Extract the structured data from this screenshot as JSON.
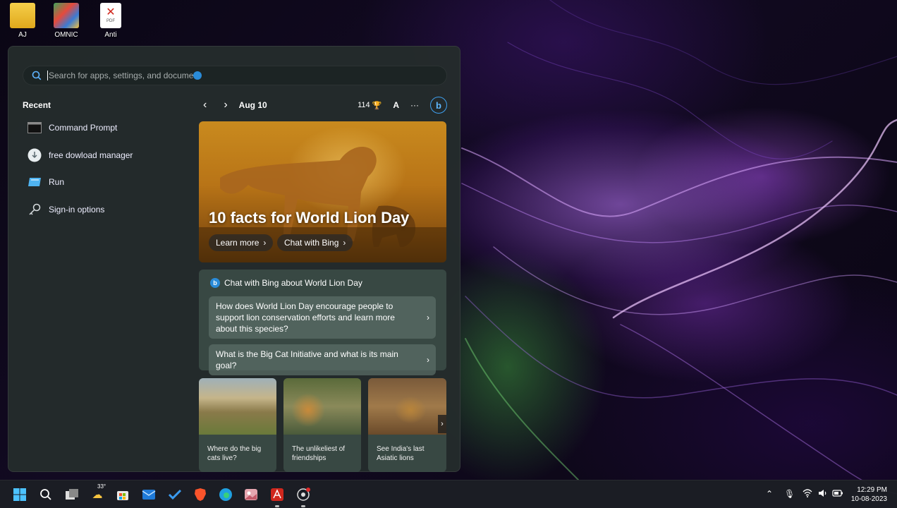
{
  "desktop": {
    "icons": [
      {
        "label": "AJ"
      },
      {
        "label": "OMNIC"
      },
      {
        "label": "Anti",
        "sub": "PDF"
      }
    ]
  },
  "start_menu": {
    "search": {
      "placeholder": "Search for apps, settings, and docume"
    },
    "recent": {
      "title": "Recent",
      "items": [
        {
          "label": "Command Prompt"
        },
        {
          "label": "free dowload manager"
        },
        {
          "label": "Run"
        },
        {
          "label": "Sign-in options"
        }
      ]
    },
    "feed": {
      "date": "Aug 10",
      "points": "114",
      "avatar_letter": "A",
      "more": "···",
      "hero": {
        "title": "10 facts for World Lion Day",
        "learn_more": "Learn more",
        "chat_with_bing": "Chat with Bing"
      },
      "chat": {
        "title": "Chat with Bing about World Lion Day",
        "questions": [
          "How does World Lion Day encourage people to support lion conservation efforts and learn more about this species?",
          "What is the Big Cat Initiative and what is its main goal?"
        ]
      },
      "tiles": [
        {
          "caption": "Where do the big cats live?"
        },
        {
          "caption": "The unlikeliest of friendships"
        },
        {
          "caption": "See India's last Asiatic lions"
        }
      ]
    }
  },
  "taskbar": {
    "weather_temp": "33°",
    "time": "12:29 PM",
    "date": "10-08-2023"
  },
  "colors": {
    "accent": "#2a8bd8",
    "panel": "#242c2c",
    "taskbar": "#1c1e24"
  }
}
